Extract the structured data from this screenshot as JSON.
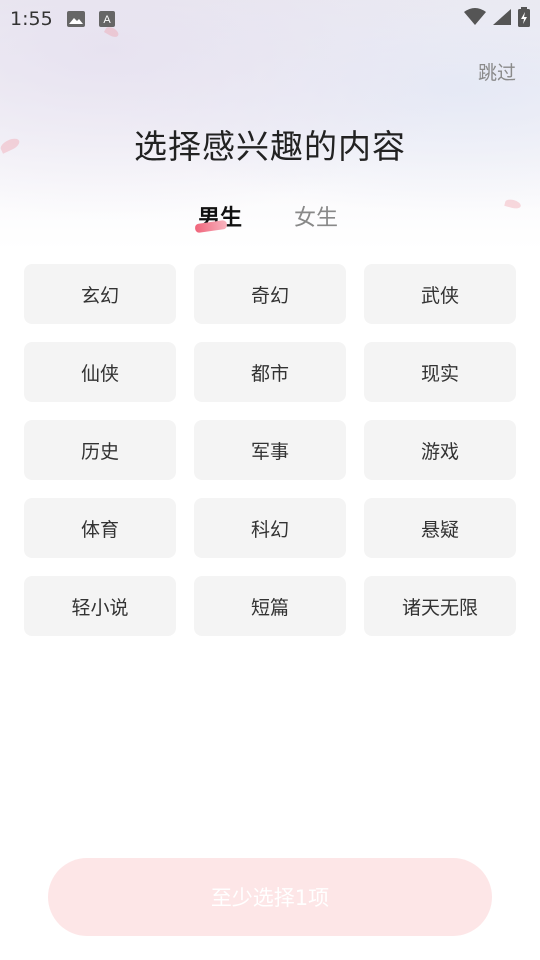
{
  "status_bar": {
    "time": "1:55",
    "left_icons": [
      "image-icon",
      "text-a-icon"
    ],
    "right_icons": [
      "wifi-icon",
      "signal-icon",
      "battery-icon"
    ]
  },
  "header": {
    "skip_label": "跳过",
    "title": "选择感兴趣的内容"
  },
  "tabs": {
    "active": "男生",
    "items": [
      {
        "label": "男生"
      },
      {
        "label": "女生"
      }
    ],
    "accent_color": "#f0647a"
  },
  "genres": [
    {
      "label": "玄幻"
    },
    {
      "label": "奇幻"
    },
    {
      "label": "武侠"
    },
    {
      "label": "仙侠"
    },
    {
      "label": "都市"
    },
    {
      "label": "现实"
    },
    {
      "label": "历史"
    },
    {
      "label": "军事"
    },
    {
      "label": "游戏"
    },
    {
      "label": "体育"
    },
    {
      "label": "科幻"
    },
    {
      "label": "悬疑"
    },
    {
      "label": "轻小说"
    },
    {
      "label": "短篇"
    },
    {
      "label": "诸天无限"
    }
  ],
  "footer": {
    "confirm_label": "至少选择1项",
    "confirm_bg": "#fde6e7"
  }
}
